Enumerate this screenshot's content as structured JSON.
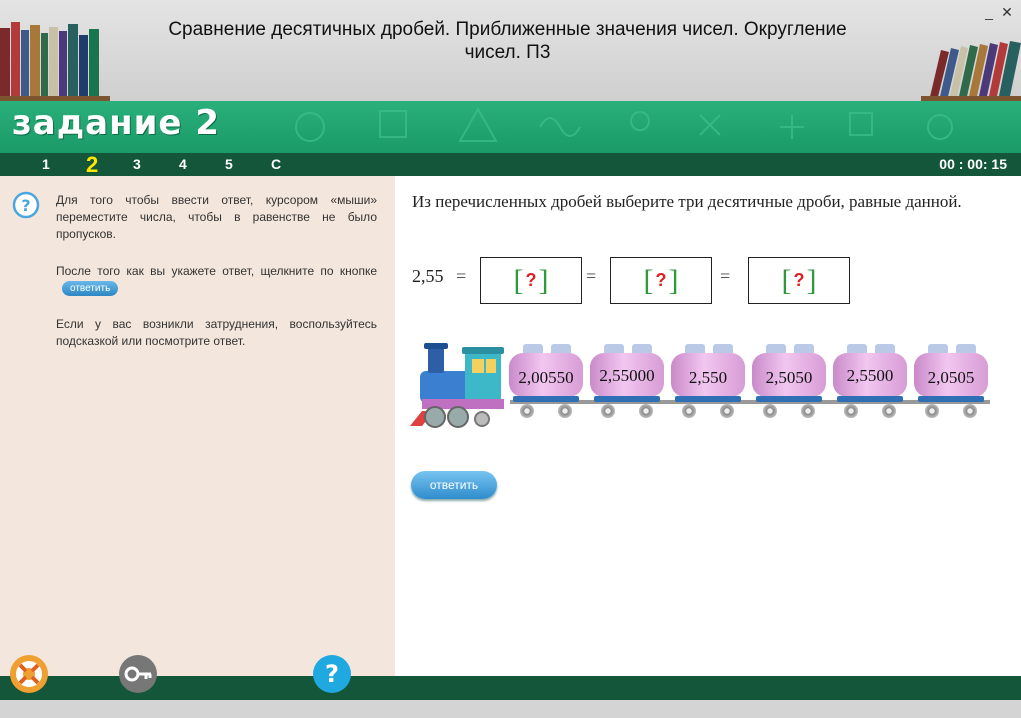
{
  "window": {
    "title": "Сравнение десятичных дробей. Приближенные значения чисел. Округление чисел. П3",
    "minimize_label": "_",
    "close_label": "✕"
  },
  "banner": {
    "task_title": "задание 2"
  },
  "nav": {
    "items": [
      "1",
      "2",
      "3",
      "4",
      "5",
      "С"
    ],
    "active": "2",
    "timer": "00 : 00: 15"
  },
  "instructions": {
    "p1": "Для того чтобы ввести ответ, курсором «мыши» переместите числа, чтобы в равенстве не было пропусков.",
    "p2_before": "После того как вы укажете ответ, щелкните по кнопке",
    "p2_button": "ответить",
    "p3": "Если у вас возникли затруднения, воспользуйтесь подсказкой или посмотрите ответ."
  },
  "task": {
    "question": "Из перечисленных дробей выберите три десятичные дроби, равные данной.",
    "given_value": "2,55",
    "equals": "=",
    "slots": [
      "?",
      "?",
      "?"
    ],
    "bracket_open": "[",
    "bracket_close": "]",
    "cars": [
      "2,00550",
      "2,55000",
      "2,550",
      "2,5050",
      "2,5500",
      "2,0505"
    ],
    "answer_label": "ответить"
  },
  "footer": {
    "buttons": [
      "lifebuoy-icon",
      "key-icon",
      "question-icon"
    ]
  },
  "colors": {
    "banner": "#1a9a68",
    "navbar": "#14563a",
    "active_nav": "#ffe600",
    "bracket": "#2e9a3c",
    "qmark": "#e02020",
    "car_body": "#e9b3e6",
    "button": "#2f8ccd"
  }
}
